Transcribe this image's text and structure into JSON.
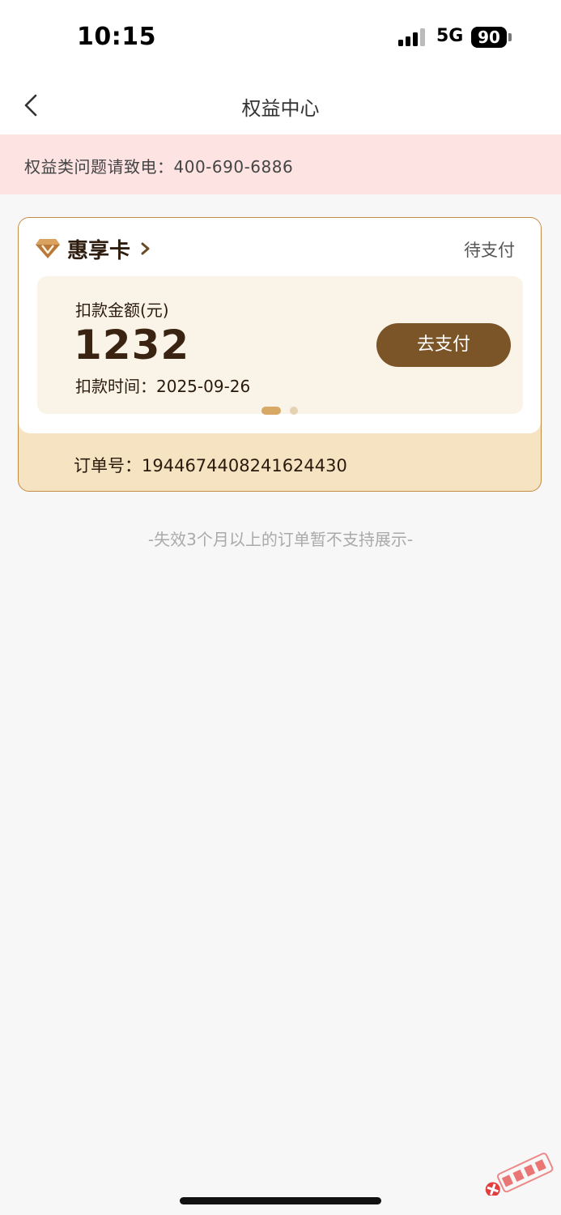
{
  "status_bar": {
    "time": "10:15",
    "network": "5G",
    "battery": "90"
  },
  "nav": {
    "title": "权益中心",
    "back_icon": "chevron-left-icon"
  },
  "notice": {
    "text": "权益类问题请致电：400-690-6886"
  },
  "card": {
    "name": "惠享卡",
    "icon": "diamond-icon",
    "status": "待支付",
    "amount_label": "扣款金额(元)",
    "amount": "1232",
    "deduct_time": "扣款时间：2025-09-26",
    "pay_label": "去支付",
    "order_label": "订单号：1944674408241624430",
    "pager": {
      "count": 2,
      "active_index": 0
    }
  },
  "tip": "-失效3个月以上的订单暂不支持展示-",
  "colors": {
    "accent": "#7b5428",
    "card_border": "#c48b44",
    "card_footer": "#f6e3c2",
    "notice_bg": "#fde4e3",
    "pager_active": "#d7a965"
  }
}
